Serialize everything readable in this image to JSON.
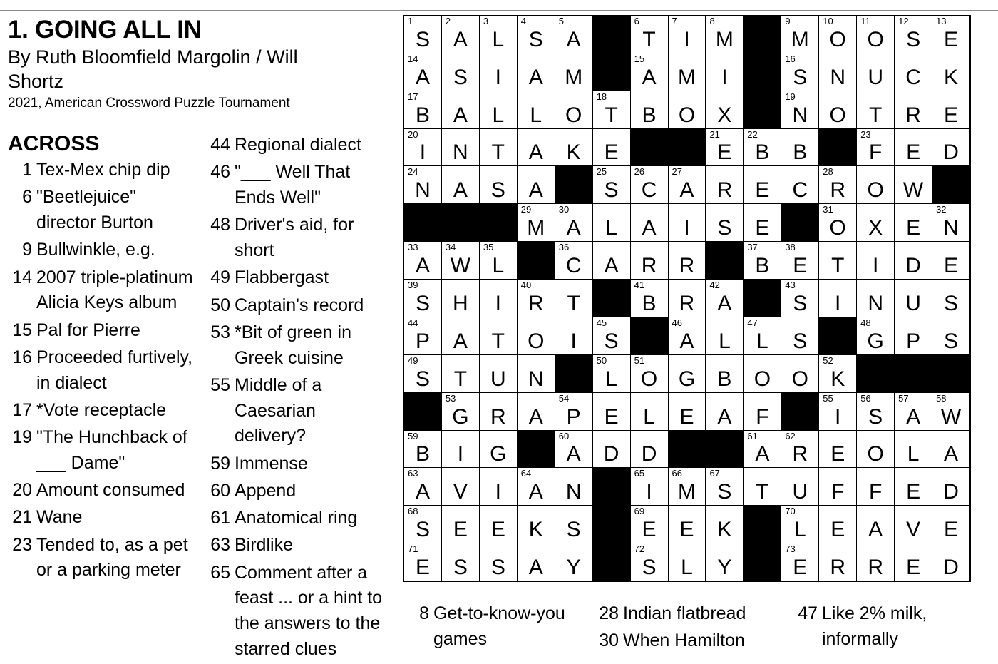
{
  "puzzle": {
    "title": "1. GOING ALL IN",
    "byline": "By Ruth Bloomfield Margolin / Will Shortz",
    "source": "2021, American Crossword Puzzle Tournament"
  },
  "across_heading": "ACROSS",
  "across_col1": [
    {
      "num": "1",
      "text": "Tex-Mex chip dip"
    },
    {
      "num": "6",
      "text": "\"Beetlejuice\" director Burton"
    },
    {
      "num": "9",
      "text": "Bullwinkle, e.g."
    },
    {
      "num": "14",
      "text": "2007 triple-platinum Alicia Keys album"
    },
    {
      "num": "15",
      "text": "Pal for Pierre"
    },
    {
      "num": "16",
      "text": "Proceeded furtively, in dialect"
    },
    {
      "num": "17",
      "text": "*Vote receptacle"
    },
    {
      "num": "19",
      "text": "\"The Hunchback of ___ Dame\""
    },
    {
      "num": "20",
      "text": "Amount consumed"
    },
    {
      "num": "21",
      "text": "Wane"
    },
    {
      "num": "23",
      "text": "Tended to, as a pet or a parking meter"
    }
  ],
  "across_col2": [
    {
      "num": "44",
      "text": "Regional dialect"
    },
    {
      "num": "46",
      "text": "\"___ Well That Ends Well\""
    },
    {
      "num": "48",
      "text": "Driver's aid, for short"
    },
    {
      "num": "49",
      "text": "Flabbergast"
    },
    {
      "num": "50",
      "text": "Captain's record"
    },
    {
      "num": "53",
      "text": "*Bit of green in Greek cuisine"
    },
    {
      "num": "55",
      "text": "Middle of a Caesarian delivery?"
    },
    {
      "num": "59",
      "text": "Immense"
    },
    {
      "num": "60",
      "text": "Append"
    },
    {
      "num": "61",
      "text": "Anatomical ring"
    },
    {
      "num": "63",
      "text": "Birdlike"
    },
    {
      "num": "65",
      "text": "Comment after a feast ... or a hint to the answers to the starred clues"
    }
  ],
  "down_col1": [
    {
      "num": "8",
      "text": "Get-to-know-you games"
    }
  ],
  "down_col2": [
    {
      "num": "28",
      "text": "Indian flatbread"
    },
    {
      "num": "30",
      "text": "When Hamilton"
    }
  ],
  "down_col3": [
    {
      "num": "47",
      "text": "Like 2% milk, informally"
    }
  ],
  "grid": {
    "rows": [
      "SALSA#TIM#MOOSE",
      "ASIAM#AMI#SNUCK",
      "BALLOTBOX#NOTRE",
      "INTAKE###EBB#FED",
      "NASA#SCARECROW#",
      "###MALAISE#OXEN",
      "AWL#CARR#BETIDE",
      "SHIRT#BRA#SINUS",
      "PATOIS#ALLS#GPS",
      "STUN#LOGBOOK###",
      "#GRAPELEAF#ISAW",
      "BIG#ADD##AREOLA",
      "AVIAN#IMSTUFFED",
      "SEEKS#EEK#LEAVE",
      "ESSAY#SLY#ERRED"
    ]
  }
}
